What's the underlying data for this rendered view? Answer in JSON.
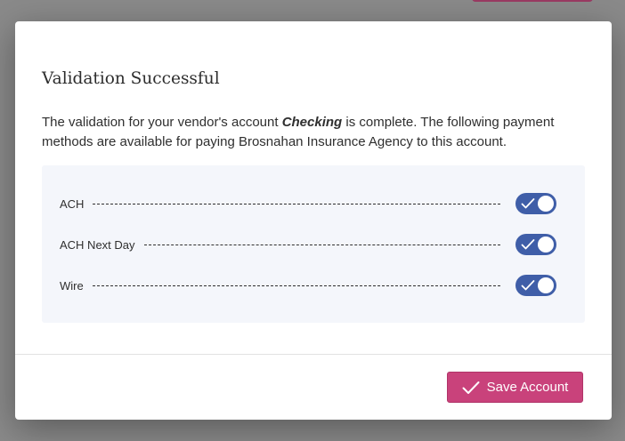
{
  "modal": {
    "title": "Validation Successful",
    "description": {
      "part1": "The validation for your vendor's account ",
      "account_name": "Checking",
      "part2": " is complete. The following payment methods are available for paying Brosnahan Insurance Agency to this account."
    },
    "payment_methods": [
      {
        "label": "ACH",
        "enabled": true
      },
      {
        "label": "ACH Next Day",
        "enabled": true
      },
      {
        "label": "Wire",
        "enabled": true
      }
    ],
    "save_button": {
      "label": "Save Account",
      "icon": "checkmark-icon"
    }
  },
  "colors": {
    "overlay": "#8a8a8a",
    "toggle_on": "#3f5ea8",
    "primary_button": "#c9427b",
    "panel_bg": "#f4f6fb"
  }
}
